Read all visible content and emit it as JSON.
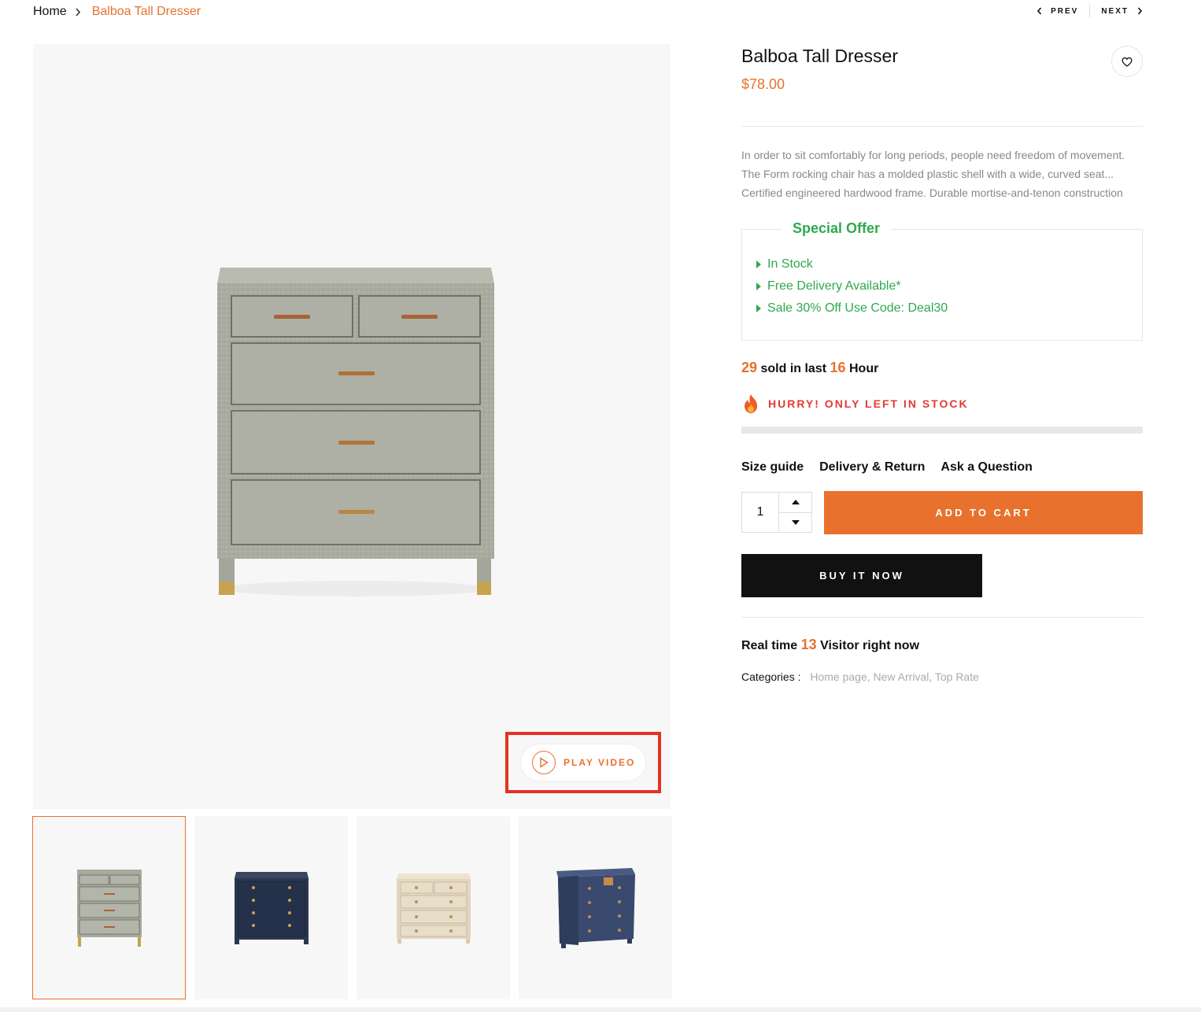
{
  "breadcrumb": {
    "home": "Home",
    "current": "Balboa Tall Dresser"
  },
  "pager": {
    "prev": "PREV",
    "next": "NEXT"
  },
  "gallery": {
    "play_video": "PLAY VIDEO",
    "thumbnails": [
      {
        "name": "grey-dresser",
        "color": "#a7aa9d"
      },
      {
        "name": "navy-dresser",
        "color": "#2b3750"
      },
      {
        "name": "cream-dresser",
        "color": "#e2d6bf"
      },
      {
        "name": "blue-chest",
        "color": "#3a4a6e"
      }
    ]
  },
  "product": {
    "title": "Balboa Tall Dresser",
    "price": "$78.00",
    "description": "In order to sit comfortably for long periods, people need freedom of movement. The Form rocking chair has a molded plastic shell with a wide, curved seat... Certified engineered hardwood frame. Durable mortise-and-tenon construction",
    "special_offer": {
      "title": "Special Offer",
      "items": [
        "In Stock",
        "Free Delivery Available*",
        "Sale 30% Off Use Code: Deal30"
      ]
    },
    "sold": {
      "count": "29",
      "mid": "sold in last",
      "hours": "16",
      "suffix": "Hour"
    },
    "hurry": "HURRY! ONLY LEFT IN STOCK",
    "links": {
      "size_guide": "Size guide",
      "delivery": "Delivery & Return",
      "ask": "Ask a Question"
    },
    "quantity": "1",
    "add_to_cart": "ADD TO CART",
    "buy_now": "BUY IT NOW",
    "visitors": {
      "prefix": "Real time",
      "count": "13",
      "suffix": "Visitor right now"
    },
    "categories": {
      "label": "Categories :",
      "list": "Home page, New Arrival, Top Rate"
    }
  },
  "colors": {
    "accent": "#e8712e",
    "offer_green": "#2fa94e",
    "alert_red": "#e53935",
    "highlight_box": "#e53220"
  }
}
